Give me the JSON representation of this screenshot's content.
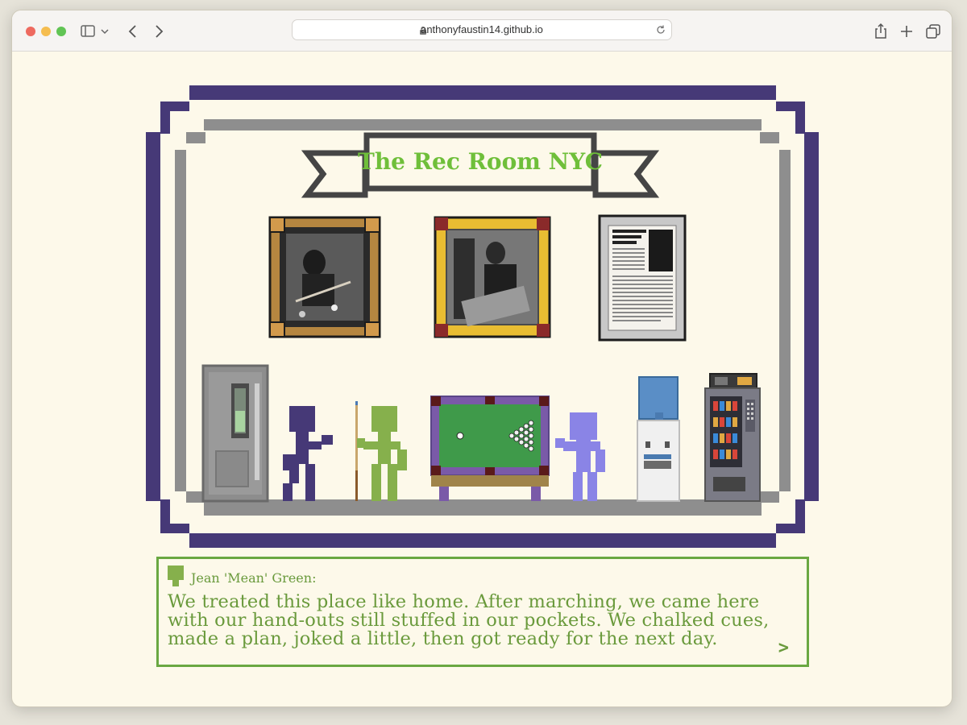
{
  "browser": {
    "url": "anthonyfaustin14.github.io",
    "traffic_lights": [
      "#ee6a5f",
      "#f5bd4f",
      "#61c454"
    ]
  },
  "scene": {
    "title": "The Rec Room NYC",
    "colors": {
      "outer_frame": "#463977",
      "inner_frame": "#8e8e8e",
      "banner": "#454545",
      "title_green": "#6fbf3a",
      "background": "#fdf9ea"
    },
    "frames": [
      {
        "name": "photo-frame-ornate",
        "style": "brown-ornate"
      },
      {
        "name": "photo-frame-gold",
        "style": "gold"
      },
      {
        "name": "newspaper-frame-silver",
        "style": "silver",
        "headline": "Cisero Murphy Wins NYC Pool Tournament!"
      }
    ],
    "objects": [
      "refrigerator",
      "purple-figure",
      "pool-cue",
      "green-figure",
      "pool-table",
      "lavender-figure",
      "water-cooler",
      "vending-machine"
    ]
  },
  "dialog": {
    "speaker": "Jean 'Mean' Green:",
    "text": "We treated this place like home. After marching, we came here with our hand-outs still stuffed in our pockets. We chalked cues, made a plan, joked a little, then got ready for the next day.",
    "next": ">"
  }
}
